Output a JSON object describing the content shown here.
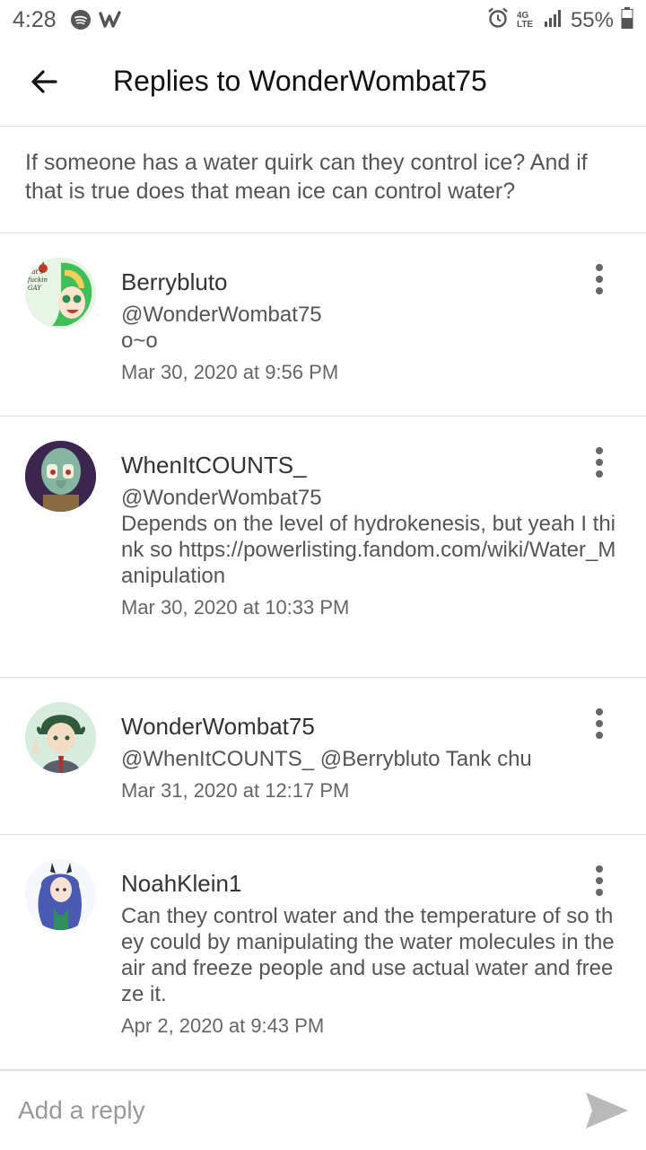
{
  "status_bar": {
    "time": "4:28",
    "network": "4G LTE",
    "battery": "55%"
  },
  "header": {
    "title": "Replies to WonderWombat75"
  },
  "original_post": {
    "text": "If someone has a water quirk can they control ice? And if that is true does that mean ice can control water?"
  },
  "replies": [
    {
      "username": "Berrybluto",
      "mention": "@WonderWombat75",
      "text": "o~o",
      "date": "Mar 30, 2020 at 9:56 PM",
      "avatar_text": "hat's fuckin GAY"
    },
    {
      "username": "WhenItCOUNTS_",
      "mention": "@WonderWombat75",
      "text": "Depends on the level of hydrokenesis, but yeah I think so https://powerlisting.fandom.com/wiki/Water_Manipulation",
      "date": "Mar 30, 2020 at 10:33 PM"
    },
    {
      "username": "WonderWombat75",
      "mention": "@WhenItCOUNTS_  @Berrybluto Tank chu",
      "date": "Mar 31, 2020 at 12:17 PM"
    },
    {
      "username": "NoahKlein1",
      "text": "Can they control water and the temperature of so they could by manipulating the water molecules in the air and freeze people and use actual water and freeze it.",
      "date": "Apr 2, 2020 at 9:43 PM"
    }
  ],
  "footer": {
    "placeholder": "Add a reply"
  },
  "icons": {
    "back": "arrow-left-icon",
    "more": "more-vertical-icon",
    "send": "send-icon",
    "status": [
      "spotify-icon",
      "wattpad-icon",
      "alarm-icon",
      "signal-icon",
      "battery-icon"
    ]
  },
  "colors": {
    "send_icon": "#b9b9b9",
    "divider": "#dcdcdc",
    "text_secondary": "#555555"
  }
}
